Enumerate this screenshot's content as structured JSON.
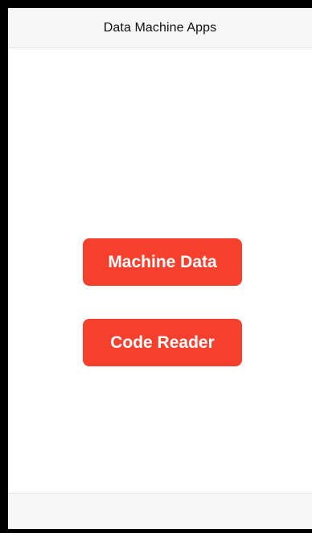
{
  "nav": {
    "title": "Data Machine Apps"
  },
  "buttons": [
    {
      "label": "Machine Data"
    },
    {
      "label": "Code Reader"
    }
  ],
  "colors": {
    "button_background": "#f6402e",
    "button_text": "#ffffff",
    "bar_background": "#f7f7f7",
    "frame": "#000000"
  }
}
